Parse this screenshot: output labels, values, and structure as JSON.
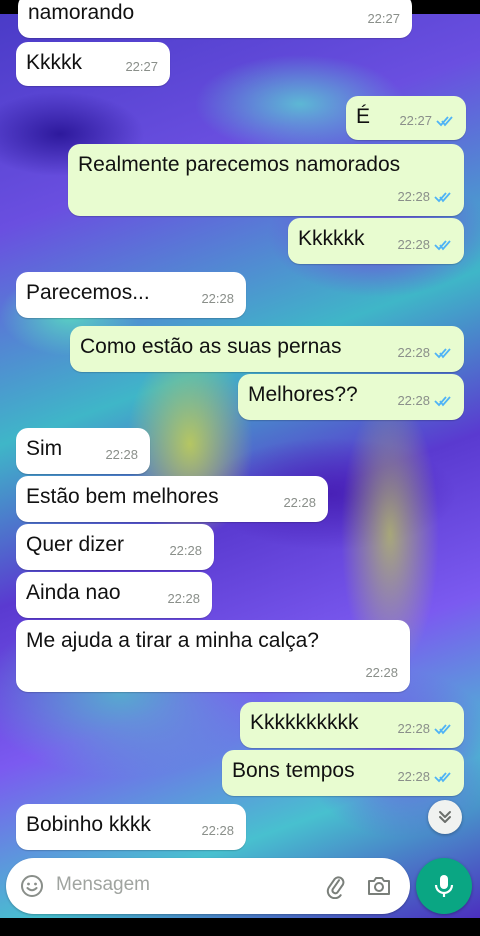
{
  "chat": {
    "messages": [
      {
        "id": "m0",
        "direction": "incoming",
        "text": "namorando",
        "time": "22:27",
        "read": false
      },
      {
        "id": "m1",
        "direction": "incoming",
        "text": "Kkkkk",
        "time": "22:27",
        "read": false
      },
      {
        "id": "m2",
        "direction": "outgoing",
        "text": "É",
        "time": "22:27",
        "read": true
      },
      {
        "id": "m3",
        "direction": "outgoing",
        "text": "Realmente parecemos namorados",
        "time": "22:28",
        "read": true
      },
      {
        "id": "m4",
        "direction": "outgoing",
        "text": "Kkkkkk",
        "time": "22:28",
        "read": true
      },
      {
        "id": "m5",
        "direction": "incoming",
        "text": "Parecemos...",
        "time": "22:28",
        "read": false
      },
      {
        "id": "m6",
        "direction": "outgoing",
        "text": "Como estão as suas pernas",
        "time": "22:28",
        "read": true
      },
      {
        "id": "m7",
        "direction": "outgoing",
        "text": "Melhores??",
        "time": "22:28",
        "read": true
      },
      {
        "id": "m8",
        "direction": "incoming",
        "text": "Sim",
        "time": "22:28",
        "read": false
      },
      {
        "id": "m9",
        "direction": "incoming",
        "text": "Estão bem melhores",
        "time": "22:28",
        "read": false
      },
      {
        "id": "m10",
        "direction": "incoming",
        "text": "Quer dizer",
        "time": "22:28",
        "read": false
      },
      {
        "id": "m11",
        "direction": "incoming",
        "text": "Ainda nao",
        "time": "22:28",
        "read": false
      },
      {
        "id": "m12",
        "direction": "incoming",
        "text": "Me ajuda a tirar a minha calça?",
        "time": "22:28",
        "read": false
      },
      {
        "id": "m13",
        "direction": "outgoing",
        "text": "Kkkkkkkkkk",
        "time": "22:28",
        "read": true
      },
      {
        "id": "m14",
        "direction": "outgoing",
        "text": "Bons tempos",
        "time": "22:28",
        "read": true
      },
      {
        "id": "m15",
        "direction": "incoming",
        "text": "Bobinho kkkk",
        "time": "22:28",
        "read": false
      }
    ]
  },
  "composer": {
    "placeholder": "Mensagem",
    "icons": [
      "emoji-icon",
      "attach-icon",
      "camera-icon",
      "mic-icon"
    ]
  },
  "scroll_button": {
    "icon": "double-chevron-down-icon"
  },
  "colors": {
    "incoming_bubble": "#ffffff",
    "outgoing_bubble": "#e8fcd0",
    "read_ticks": "#4fb3f6",
    "mic_button": "#0aa683"
  }
}
